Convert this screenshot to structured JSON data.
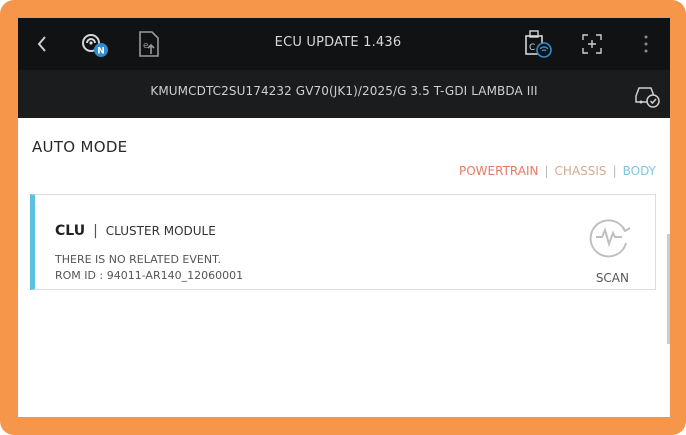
{
  "header": {
    "title": "ECU UPDATE 1.436",
    "vehicle_info": "KMUMCDTC2SU174232  GV70(JK1)/2025/G 3.5 T-GDI LAMBDA III"
  },
  "icons": {
    "back": "back-arrow-icon",
    "vci_status": "vci-connection-icon",
    "file": "file-upload-icon",
    "ecu": "ecu-wireless-icon",
    "screenshot": "screen-capture-icon",
    "menu": "more-vertical-icon",
    "vehicle": "vehicle-check-icon"
  },
  "main": {
    "mode_title": "AUTO MODE",
    "filters": [
      {
        "label": "POWERTRAIN",
        "color": "#e87a63"
      },
      {
        "label": "CHASSIS",
        "color": "#d8a88f"
      },
      {
        "label": "BODY",
        "color": "#7ec7e2"
      }
    ],
    "cards": [
      {
        "code": "CLU",
        "name": "CLUSTER MODULE",
        "event_text": "THERE IS NO RELATED EVENT.",
        "rom_id": "ROM ID : 94011-AR140_12060001",
        "action_label": "SCAN",
        "accent_color": "#5cc0e0"
      }
    ]
  }
}
